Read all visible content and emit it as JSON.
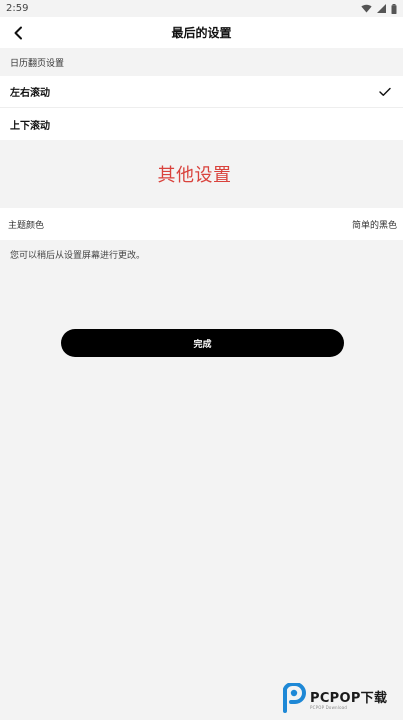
{
  "status_bar": {
    "time": "2:59"
  },
  "header": {
    "title": "最后的设置"
  },
  "calendar_section": {
    "header": "日历翻页设置",
    "options": [
      {
        "label": "左右滚动",
        "selected": true
      },
      {
        "label": "上下滚动",
        "selected": false
      }
    ]
  },
  "other": {
    "title": "其他设置"
  },
  "theme": {
    "label": "主题颜色",
    "value": "简单的黑色"
  },
  "note": "您可以稍后从设置屏幕进行更改。",
  "done_label": "完成",
  "watermark": {
    "text": "PCPOP下载",
    "sub": "PCPOP Download"
  },
  "colors": {
    "accent": "#d9423c",
    "button": "#000000",
    "background": "#f3f3f3",
    "watermark_blue": "#1e88d6"
  }
}
